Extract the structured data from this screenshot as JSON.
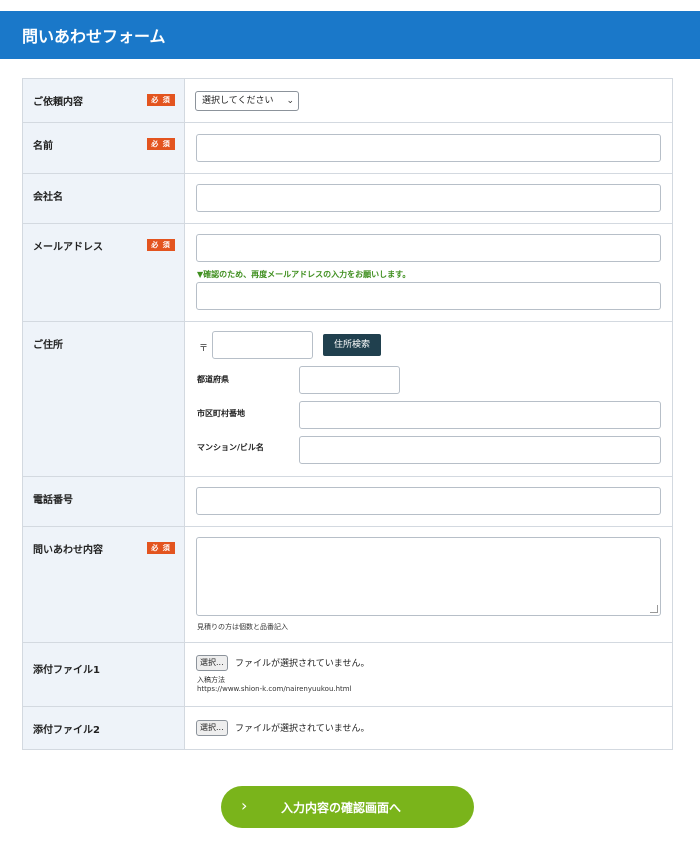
{
  "header": {
    "title": "問いあわせフォーム"
  },
  "required_badge": "必 須",
  "rows": {
    "inquiry_type": {
      "label": "ご依頼内容",
      "select_value": "選択してください"
    },
    "name": {
      "label": "名前"
    },
    "company": {
      "label": "会社名"
    },
    "email": {
      "label": "メールアドレス",
      "confirm_note": "▼確認のため、再度メールアドレスの入力をお願いします。"
    },
    "address": {
      "label": "ご住所",
      "postal_mark": "〒",
      "search_button": "住所検索",
      "prefecture_label": "都道府県",
      "city_label": "市区町村番地",
      "building_label": "マンション/ビル名"
    },
    "phone": {
      "label": "電話番号"
    },
    "message": {
      "label": "問いあわせ内容",
      "hint": "見積りの方は個数と品番記入"
    },
    "file1": {
      "label": "添付ファイル1",
      "button": "選択...",
      "status": "ファイルが選択されていません。",
      "note_title": "入稿方法",
      "note_url": "https://www.shion-k.com/nairenyuukou.html"
    },
    "file2": {
      "label": "添付ファイル2",
      "button": "選択...",
      "status": "ファイルが選択されていません。"
    }
  },
  "submit": {
    "label": "入力内容の確認画面へ",
    "icon": "chevron-right-icon"
  },
  "colors": {
    "header_bg": "#1a78c9",
    "badge": "#e3541f",
    "submit": "#7ab41b",
    "note_green": "#3f8f1f"
  }
}
